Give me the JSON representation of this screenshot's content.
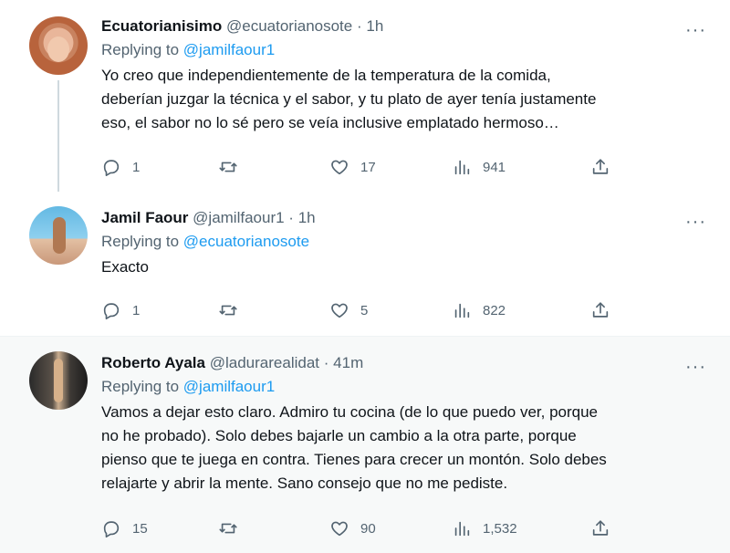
{
  "tweets": [
    {
      "name": "Ecuatorianisimo",
      "handle": "@ecuatorianosote",
      "dot": "·",
      "time": "1h",
      "replying_prefix": "Replying to",
      "replying_to": "@jamilfaour1",
      "text_lines": [
        "Yo creo que independientemente de la temperatura de la comida,",
        "deberían juzgar la técnica y el sabor, y tu plato de ayer tenía justamente",
        "eso, el sabor no lo sé pero se veía inclusive emplatado hermoso…"
      ],
      "replies": "1",
      "retweets": "",
      "likes": "17",
      "views": "941"
    },
    {
      "name": "Jamil Faour",
      "handle": "@jamilfaour1",
      "dot": "·",
      "time": "1h",
      "replying_prefix": "Replying to",
      "replying_to": "@ecuatorianosote",
      "text_lines": [
        "Exacto"
      ],
      "replies": "1",
      "retweets": "",
      "likes": "5",
      "views": "822"
    },
    {
      "name": "Roberto Ayala",
      "handle": "@ladurarealidat",
      "dot": "·",
      "time": "41m",
      "replying_prefix": "Replying to",
      "replying_to": "@jamilfaour1",
      "text_lines": [
        "Vamos a dejar esto claro. Admiro tu cocina (de lo que puedo ver, porque",
        "no he probado). Solo debes bajarle un cambio a la otra parte, porque",
        "pienso que te juega en contra. Tienes para crecer un montón. Solo debes",
        "relajarte y abrir la mente. Sano consejo que no me pediste."
      ],
      "replies": "15",
      "retweets": "",
      "likes": "90",
      "views": "1,532"
    }
  ],
  "more_label": "···",
  "colors": {
    "text": "#0f1419",
    "secondary": "#536471",
    "link": "#1d9bf0",
    "highlight_bg": "#f7f9f9"
  },
  "icons": [
    "reply-icon",
    "retweet-icon",
    "like-icon",
    "views-icon",
    "share-icon",
    "more-icon"
  ]
}
